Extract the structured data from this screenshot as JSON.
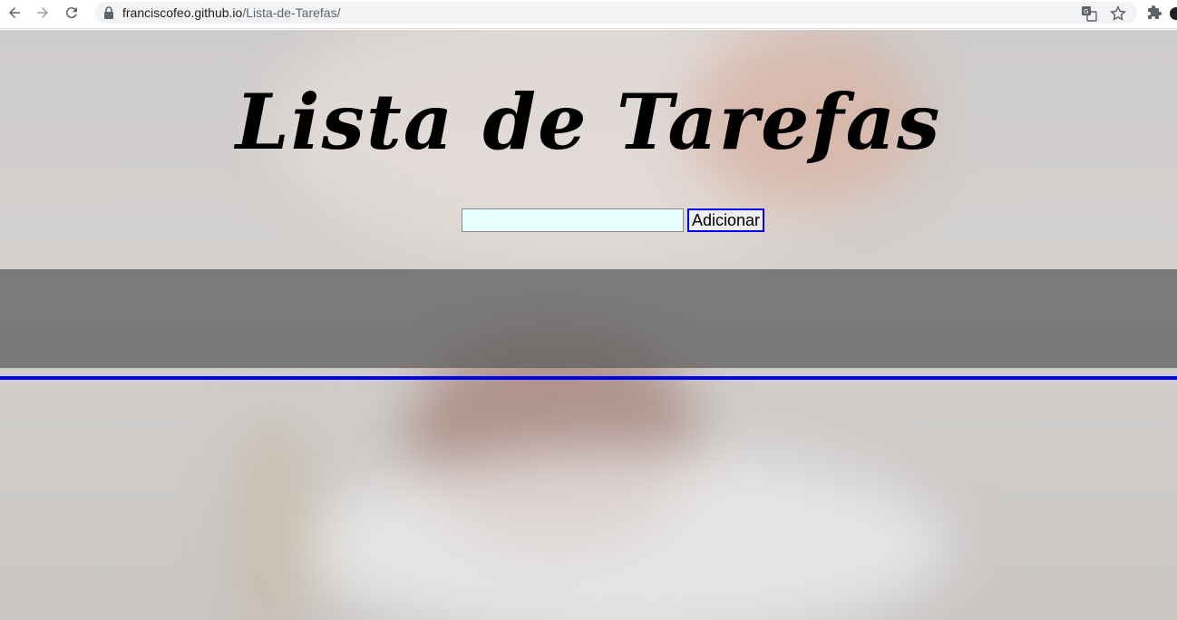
{
  "browser": {
    "url_host": "franciscofeo.github.io",
    "url_path": "/Lista-de-Tarefas/",
    "icons": [
      "back-icon",
      "forward-icon",
      "reload-icon",
      "lock-icon",
      "translate-icon",
      "star-icon",
      "extensions-icon"
    ]
  },
  "page": {
    "title": "Lista de Tarefas",
    "input": {
      "value": "",
      "placeholder": ""
    },
    "add_button_label": "Adicionar"
  },
  "colors": {
    "input_background": "#e8ffff",
    "button_border": "#0000ee",
    "divider": "#0000ee",
    "list_panel": "#5a5a5a"
  }
}
